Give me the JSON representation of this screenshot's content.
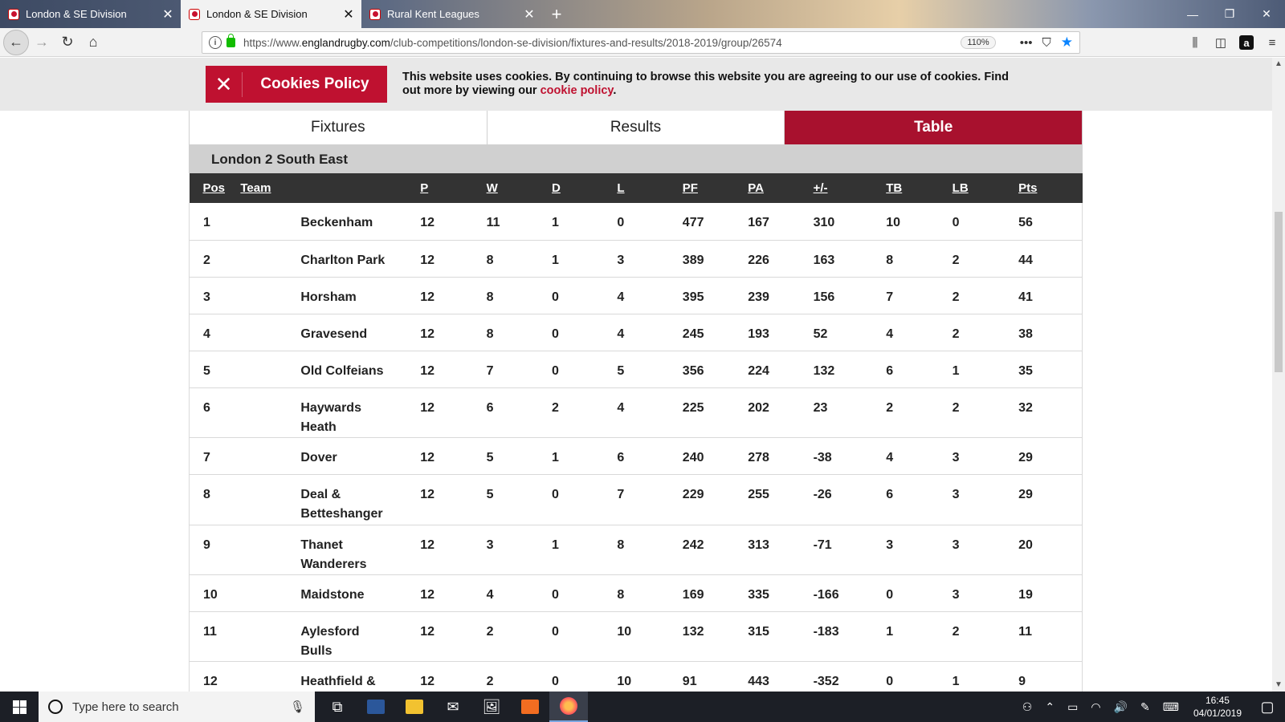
{
  "browser": {
    "tabs": [
      {
        "label": "London & SE Division",
        "active": false
      },
      {
        "label": "London & SE Division",
        "active": true
      },
      {
        "label": "Rural Kent Leagues",
        "active": false
      }
    ],
    "url_prefix": "https://www.",
    "url_domain": "englandrugby.com",
    "url_path": "/club-competitions/london-se-division/fixtures-and-results/2018-2019/group/26574",
    "zoom": "110%"
  },
  "cookie": {
    "title": "Cookies Policy",
    "text": "This website uses cookies. By continuing to browse this website you are agreeing to our use of cookies. Find out more by viewing our ",
    "link": "cookie policy",
    "suffix": "."
  },
  "segments": [
    "Fixtures",
    "Results",
    "Table"
  ],
  "active_segment": "Table",
  "group_name": "London 2 South East",
  "table": {
    "headers": [
      "Pos",
      "Team",
      "P",
      "W",
      "D",
      "L",
      "PF",
      "PA",
      "+/-",
      "TB",
      "LB",
      "Pts"
    ],
    "rows": [
      {
        "pos": "1",
        "team": "Beckenham",
        "p": "12",
        "w": "11",
        "d": "1",
        "l": "0",
        "pf": "477",
        "pa": "167",
        "diff": "310",
        "tb": "10",
        "lb": "0",
        "pts": "56"
      },
      {
        "pos": "2",
        "team": "Charlton Park",
        "p": "12",
        "w": "8",
        "d": "1",
        "l": "3",
        "pf": "389",
        "pa": "226",
        "diff": "163",
        "tb": "8",
        "lb": "2",
        "pts": "44"
      },
      {
        "pos": "3",
        "team": "Horsham",
        "p": "12",
        "w": "8",
        "d": "0",
        "l": "4",
        "pf": "395",
        "pa": "239",
        "diff": "156",
        "tb": "7",
        "lb": "2",
        "pts": "41"
      },
      {
        "pos": "4",
        "team": "Gravesend",
        "p": "12",
        "w": "8",
        "d": "0",
        "l": "4",
        "pf": "245",
        "pa": "193",
        "diff": "52",
        "tb": "4",
        "lb": "2",
        "pts": "38"
      },
      {
        "pos": "5",
        "team": "Old Colfeians",
        "p": "12",
        "w": "7",
        "d": "0",
        "l": "5",
        "pf": "356",
        "pa": "224",
        "diff": "132",
        "tb": "6",
        "lb": "1",
        "pts": "35"
      },
      {
        "pos": "6",
        "team": "Haywards Heath",
        "p": "12",
        "w": "6",
        "d": "2",
        "l": "4",
        "pf": "225",
        "pa": "202",
        "diff": "23",
        "tb": "2",
        "lb": "2",
        "pts": "32"
      },
      {
        "pos": "7",
        "team": "Dover",
        "p": "12",
        "w": "5",
        "d": "1",
        "l": "6",
        "pf": "240",
        "pa": "278",
        "diff": "-38",
        "tb": "4",
        "lb": "3",
        "pts": "29"
      },
      {
        "pos": "8",
        "team": "Deal & Betteshanger",
        "p": "12",
        "w": "5",
        "d": "0",
        "l": "7",
        "pf": "229",
        "pa": "255",
        "diff": "-26",
        "tb": "6",
        "lb": "3",
        "pts": "29"
      },
      {
        "pos": "9",
        "team": "Thanet Wanderers",
        "p": "12",
        "w": "3",
        "d": "1",
        "l": "8",
        "pf": "242",
        "pa": "313",
        "diff": "-71",
        "tb": "3",
        "lb": "3",
        "pts": "20"
      },
      {
        "pos": "10",
        "team": "Maidstone",
        "p": "12",
        "w": "4",
        "d": "0",
        "l": "8",
        "pf": "169",
        "pa": "335",
        "diff": "-166",
        "tb": "0",
        "lb": "3",
        "pts": "19"
      },
      {
        "pos": "11",
        "team": "Aylesford Bulls",
        "p": "12",
        "w": "2",
        "d": "0",
        "l": "10",
        "pf": "132",
        "pa": "315",
        "diff": "-183",
        "tb": "1",
        "lb": "2",
        "pts": "11"
      },
      {
        "pos": "12",
        "team": "Heathfield & Waldron",
        "p": "12",
        "w": "2",
        "d": "0",
        "l": "10",
        "pf": "91",
        "pa": "443",
        "diff": "-352",
        "tb": "0",
        "lb": "1",
        "pts": "9"
      }
    ]
  },
  "taskbar": {
    "search_placeholder": "Type here to search",
    "time": "16:45",
    "date": "04/01/2019"
  },
  "colors": {
    "accent": "#bf1130",
    "active_tab": "#a8112e",
    "table_header": "#333333"
  }
}
